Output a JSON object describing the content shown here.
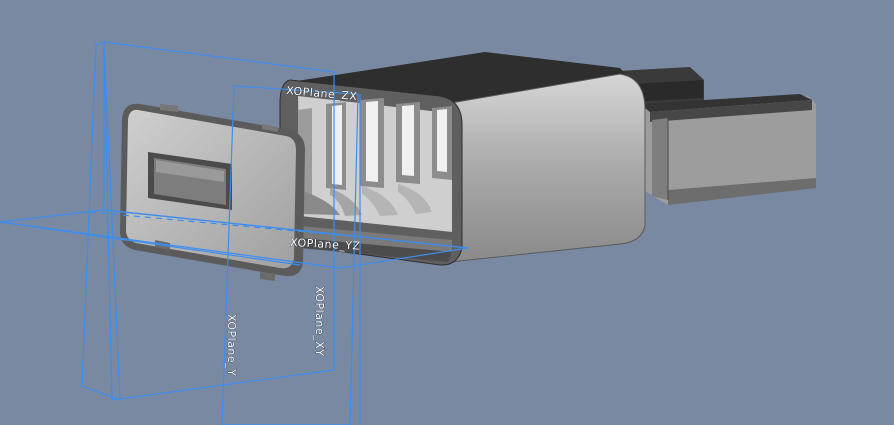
{
  "viewport": {
    "background": "#7a89a2",
    "plane_color": "#3d8df0"
  },
  "planes": [
    {
      "name": "plane-top",
      "label": "XOPlane_ZX"
    },
    {
      "name": "plane-left",
      "label": "XOPlane_YZ"
    },
    {
      "name": "plane-right-vertical",
      "label": "XOPlane_XY"
    },
    {
      "name": "plane-left-vertical",
      "label": "XOPlane_Y"
    }
  ]
}
